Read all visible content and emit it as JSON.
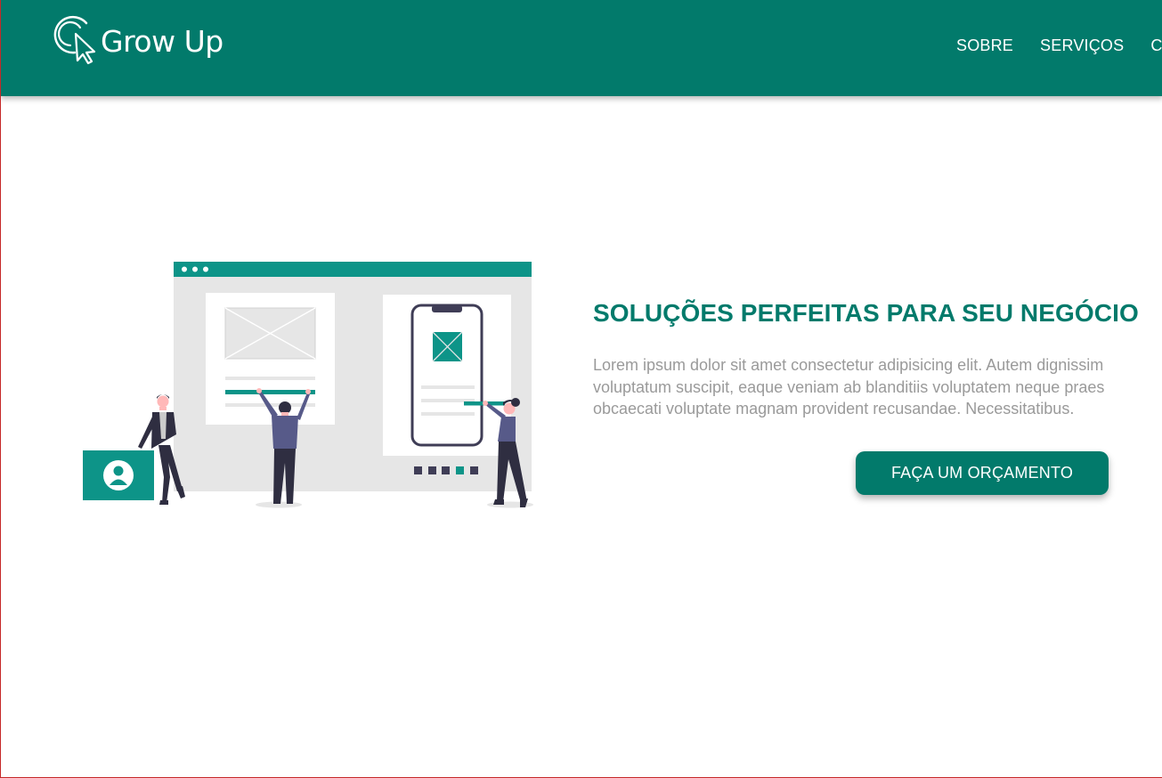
{
  "header": {
    "brand": "Grow Up",
    "logo_icon": "cursor-click-icon",
    "nav": [
      "SOBRE",
      "SERVIÇOS",
      "CO"
    ]
  },
  "hero": {
    "title": "SOLUÇÕES PERFEITAS PARA SEU NEGÓCIO",
    "text_lines": [
      "Lorem ipsum dolor sit amet consectetur adipisicing elit. Autem dignissim",
      "voluptatum suscipit, eaque veniam ab blanditiis voluptatem neque praes",
      "obcaecati voluptate magnam provident recusandae. Necessitatibus."
    ],
    "cta_label": "FAÇA UM ORÇAMENTO",
    "illustration": "team-building-website-illustration"
  },
  "colors": {
    "primary": "#027a6b",
    "accent": "#0d9488",
    "text_muted": "#9a9a9a",
    "dark": "#3f3d56"
  }
}
